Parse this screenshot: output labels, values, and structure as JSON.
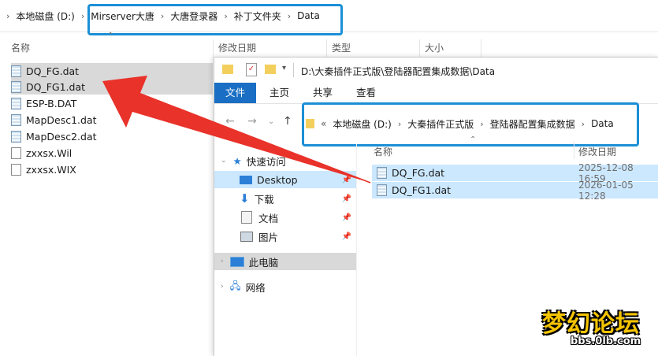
{
  "back_window": {
    "address": {
      "crumbs": [
        "本地磁盘 (D:)",
        "Mirserver大唐",
        "大唐登录器",
        "补丁文件夹",
        "Data"
      ]
    },
    "columns": {
      "name": "名称",
      "modified": "修改日期",
      "type": "类型",
      "size": "大小"
    },
    "files": [
      {
        "name": "DQ_FG.dat",
        "selected": true
      },
      {
        "name": "DQ_FG1.dat",
        "selected": true
      },
      {
        "name": "ESP-B.DAT",
        "selected": false
      },
      {
        "name": "MapDesc1.dat",
        "selected": false
      },
      {
        "name": "MapDesc2.dat",
        "selected": false
      },
      {
        "name": "zxxsx.Wil",
        "selected": false
      },
      {
        "name": "zxxsx.WIX",
        "selected": false
      }
    ]
  },
  "front_window": {
    "title": "D:\\大秦插件正式版\\登陆器配置集成数据\\Data",
    "ribbon_tabs": [
      "文件",
      "主页",
      "共享",
      "查看"
    ],
    "address": {
      "overflow": "«",
      "crumbs": [
        "本地磁盘 (D:)",
        "大秦插件正式版",
        "登陆器配置集成数据",
        "Data"
      ]
    },
    "columns": {
      "name": "名称",
      "modified": "修改日期"
    },
    "sidebar": {
      "quick_access": "快速访问",
      "desktop": "Desktop",
      "downloads": "下载",
      "documents": "文档",
      "pictures": "图片",
      "this_pc": "此电脑",
      "network": "网络"
    },
    "files": [
      {
        "name": "DQ_FG.dat",
        "modified": "2025-12-08 16:59"
      },
      {
        "name": "DQ_FG1.dat",
        "modified": "2026-01-05 12:28"
      }
    ]
  },
  "logo": {
    "title": "梦幻论坛",
    "url": "bbs.0lb.com"
  },
  "colors": {
    "highlight": "#1c8fd6",
    "arrow": "#e8322a",
    "ribbon_file": "#1a6fc4",
    "selection": "#cce8ff"
  }
}
